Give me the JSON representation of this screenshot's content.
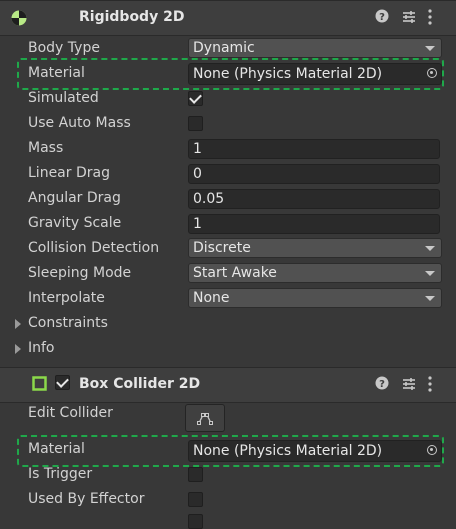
{
  "rigidbody": {
    "title": "Rigidbody 2D",
    "fields": {
      "body_type_label": "Body Type",
      "body_type_value": "Dynamic",
      "material_label": "Material",
      "material_value": "None (Physics Material 2D)",
      "simulated_label": "Simulated",
      "simulated_checked": true,
      "use_auto_mass_label": "Use Auto Mass",
      "use_auto_mass_checked": false,
      "mass_label": "Mass",
      "mass_value": "1",
      "linear_drag_label": "Linear Drag",
      "linear_drag_value": "0",
      "angular_drag_label": "Angular Drag",
      "angular_drag_value": "0.05",
      "gravity_scale_label": "Gravity Scale",
      "gravity_scale_value": "1",
      "collision_detection_label": "Collision Detection",
      "collision_detection_value": "Discrete",
      "sleeping_mode_label": "Sleeping Mode",
      "sleeping_mode_value": "Start Awake",
      "interpolate_label": "Interpolate",
      "interpolate_value": "None",
      "constraints_label": "Constraints",
      "info_label": "Info"
    }
  },
  "box_collider": {
    "title": "Box Collider 2D",
    "enabled": true,
    "fields": {
      "edit_collider_label": "Edit Collider",
      "material_label": "Material",
      "material_value": "None (Physics Material 2D)",
      "is_trigger_label": "Is Trigger",
      "is_trigger_checked": false,
      "used_by_effector_label": "Used By Effector",
      "used_by_effector_checked": false
    }
  },
  "icons": {
    "rigidbody": "rigidbody-icon",
    "collider": "box-collider-icon",
    "help": "help-icon",
    "presets": "presets-icon",
    "menu": "kebab-menu-icon",
    "object_picker": "object-picker-icon",
    "edit_collider": "edit-collider-icon"
  },
  "colors": {
    "highlight": "#1fa84a",
    "background": "#383838",
    "header": "#3e3e3e"
  }
}
